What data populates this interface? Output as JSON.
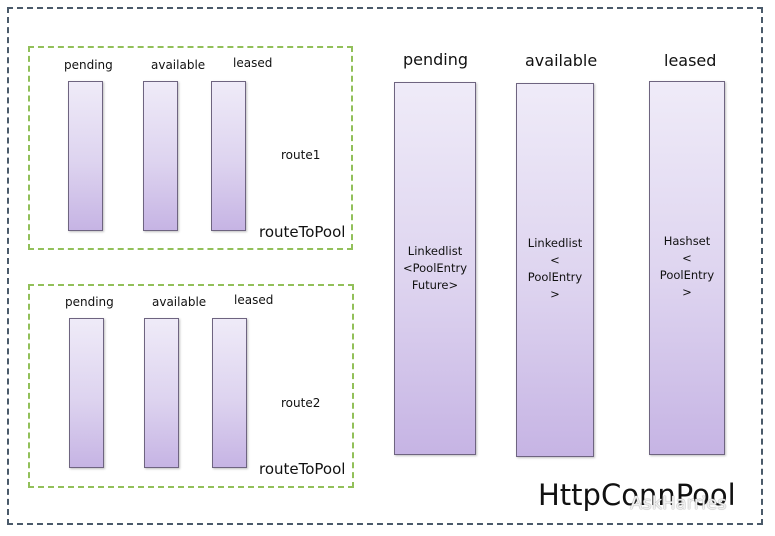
{
  "diagram": {
    "title": "HttpConnPool",
    "watermark": "AskHarries",
    "colors": {
      "outer_border": "#4a5a6a",
      "route_border": "#92c05a",
      "column_fill_top": "#efebf8",
      "column_fill_bottom": "#c6b4e4",
      "column_border": "#6e6480"
    },
    "routes": [
      {
        "name": "route1",
        "container_label": "routeToPool",
        "columns": [
          "pending",
          "available",
          "leased"
        ]
      },
      {
        "name": "route2",
        "container_label": "routeToPool",
        "columns": [
          "pending",
          "available",
          "leased"
        ]
      }
    ],
    "pool_columns": [
      {
        "label": "pending",
        "content": "Linkedlist\n<PoolEntry\nFuture>"
      },
      {
        "label": "available",
        "content": "Linkedlist\n<\nPoolEntry\n>"
      },
      {
        "label": "leased",
        "content": "Hashset\n<\nPoolEntry\n>"
      }
    ]
  }
}
